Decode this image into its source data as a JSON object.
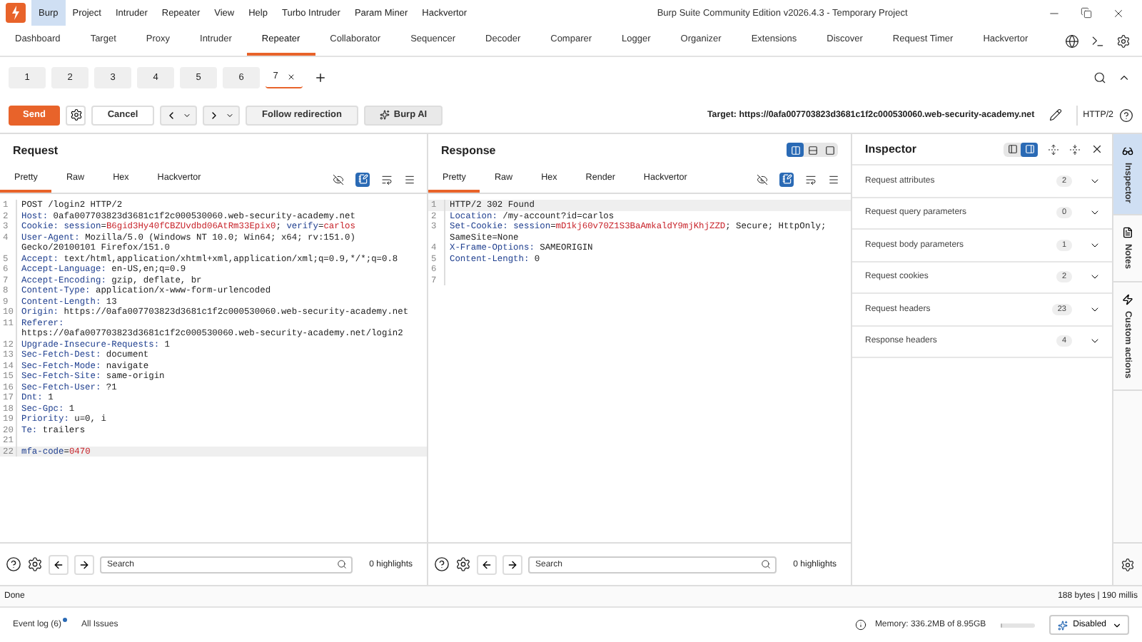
{
  "window": {
    "title": "Burp Suite Community Edition v2026.4.3 - Temporary Project"
  },
  "menu": [
    {
      "label": "Burp",
      "selected": true
    },
    {
      "label": "Project",
      "selected": false
    },
    {
      "label": "Intruder",
      "selected": false
    },
    {
      "label": "Repeater",
      "selected": false
    },
    {
      "label": "View",
      "selected": false
    },
    {
      "label": "Help",
      "selected": false
    },
    {
      "label": "Turbo Intruder",
      "selected": false
    },
    {
      "label": "Param Miner",
      "selected": false
    },
    {
      "label": "Hackvertor",
      "selected": false
    }
  ],
  "tabs": [
    {
      "label": "Dashboard",
      "selected": false
    },
    {
      "label": "Target",
      "selected": false
    },
    {
      "label": "Proxy",
      "selected": false
    },
    {
      "label": "Intruder",
      "selected": false
    },
    {
      "label": "Repeater",
      "selected": true
    },
    {
      "label": "Collaborator",
      "selected": false
    },
    {
      "label": "Sequencer",
      "selected": false
    },
    {
      "label": "Decoder",
      "selected": false
    },
    {
      "label": "Comparer",
      "selected": false
    },
    {
      "label": "Logger",
      "selected": false
    },
    {
      "label": "Organizer",
      "selected": false
    },
    {
      "label": "Extensions",
      "selected": false
    },
    {
      "label": "Discover",
      "selected": false
    },
    {
      "label": "Request Timer",
      "selected": false
    },
    {
      "label": "Hackvertor",
      "selected": false
    }
  ],
  "repeater_tabs": [
    {
      "label": "1",
      "selected": false
    },
    {
      "label": "2",
      "selected": false
    },
    {
      "label": "3",
      "selected": false
    },
    {
      "label": "4",
      "selected": false
    },
    {
      "label": "5",
      "selected": false
    },
    {
      "label": "6",
      "selected": false
    },
    {
      "label": "7",
      "selected": true
    }
  ],
  "toolbar": {
    "send": "Send",
    "cancel": "Cancel",
    "follow": "Follow redirection",
    "ai": "Burp AI",
    "target": "Target: https://0afa007703823d3681c1f2c000530060.web-security-academy.net",
    "protocol": "HTTP/2"
  },
  "request": {
    "title": "Request",
    "tabs": [
      {
        "label": "Pretty",
        "selected": true
      },
      {
        "label": "Raw",
        "selected": false
      },
      {
        "label": "Hex",
        "selected": false
      },
      {
        "label": "Hackvertor",
        "selected": false
      }
    ],
    "lines": [
      {
        "number": "1",
        "current": false,
        "segments": [
          {
            "text": "POST /login2 HTTP/2",
            "kind": "plain"
          }
        ]
      },
      {
        "number": "2",
        "current": false,
        "segments": [
          {
            "text": "Host:",
            "kind": "key"
          },
          {
            "text": " 0afa007703823d3681c1f2c000530060.web-security-academy.net",
            "kind": "plain"
          }
        ]
      },
      {
        "number": "3",
        "current": false,
        "segments": [
          {
            "text": "Cookie:",
            "kind": "key"
          },
          {
            "text": " session",
            "kind": "key"
          },
          {
            "text": "=",
            "kind": "plain"
          },
          {
            "text": "B6gid3Hy40fCBZUvdbd06AtRm33Epix0",
            "kind": "val"
          },
          {
            "text": "; ",
            "kind": "plain"
          },
          {
            "text": "verify",
            "kind": "key"
          },
          {
            "text": "=",
            "kind": "plain"
          },
          {
            "text": "carlos",
            "kind": "val"
          }
        ]
      },
      {
        "number": "4",
        "current": false,
        "segments": [
          {
            "text": "User-Agent:",
            "kind": "key"
          },
          {
            "text": " Mozilla/5.0 (Windows NT 10.0; Win64; x64; rv:151.0)",
            "kind": "plain"
          }
        ]
      },
      {
        "current": false,
        "segments": [
          {
            "text": "Gecko/20100101 Firefox/151.0",
            "kind": "plain"
          }
        ]
      },
      {
        "number": "5",
        "current": false,
        "segments": [
          {
            "text": "Accept:",
            "kind": "key"
          },
          {
            "text": " text/html,application/xhtml+xml,application/xml;q=0.9,*/*;q=0.8",
            "kind": "plain"
          }
        ]
      },
      {
        "number": "6",
        "current": false,
        "segments": [
          {
            "text": "Accept-Language:",
            "kind": "key"
          },
          {
            "text": " en-US,en;q=0.9",
            "kind": "plain"
          }
        ]
      },
      {
        "number": "7",
        "current": false,
        "segments": [
          {
            "text": "Accept-Encoding:",
            "kind": "key"
          },
          {
            "text": " gzip, deflate, br",
            "kind": "plain"
          }
        ]
      },
      {
        "number": "8",
        "current": false,
        "segments": [
          {
            "text": "Content-Type:",
            "kind": "key"
          },
          {
            "text": " application/x-www-form-urlencoded",
            "kind": "plain"
          }
        ]
      },
      {
        "number": "9",
        "current": false,
        "segments": [
          {
            "text": "Content-Length:",
            "kind": "key"
          },
          {
            "text": " 13",
            "kind": "plain"
          }
        ]
      },
      {
        "number": "10",
        "current": false,
        "segments": [
          {
            "text": "Origin:",
            "kind": "key"
          },
          {
            "text": " https://0afa007703823d3681c1f2c000530060.web-security-academy.net",
            "kind": "plain"
          }
        ]
      },
      {
        "number": "11",
        "current": false,
        "segments": [
          {
            "text": "Referer:",
            "kind": "key"
          }
        ]
      },
      {
        "current": false,
        "segments": [
          {
            "text": "https://0afa007703823d3681c1f2c000530060.web-security-academy.net/login2",
            "kind": "plain"
          }
        ]
      },
      {
        "number": "12",
        "current": false,
        "segments": [
          {
            "text": "Upgrade-Insecure-Requests:",
            "kind": "key"
          },
          {
            "text": " 1",
            "kind": "plain"
          }
        ]
      },
      {
        "number": "13",
        "current": false,
        "segments": [
          {
            "text": "Sec-Fetch-Dest:",
            "kind": "key"
          },
          {
            "text": " document",
            "kind": "plain"
          }
        ]
      },
      {
        "number": "14",
        "current": false,
        "segments": [
          {
            "text": "Sec-Fetch-Mode:",
            "kind": "key"
          },
          {
            "text": " navigate",
            "kind": "plain"
          }
        ]
      },
      {
        "number": "15",
        "current": false,
        "segments": [
          {
            "text": "Sec-Fetch-Site:",
            "kind": "key"
          },
          {
            "text": " same-origin",
            "kind": "plain"
          }
        ]
      },
      {
        "number": "16",
        "current": false,
        "segments": [
          {
            "text": "Sec-Fetch-User:",
            "kind": "key"
          },
          {
            "text": " ?1",
            "kind": "plain"
          }
        ]
      },
      {
        "number": "17",
        "current": false,
        "segments": [
          {
            "text": "Dnt:",
            "kind": "key"
          },
          {
            "text": " 1",
            "kind": "plain"
          }
        ]
      },
      {
        "number": "18",
        "current": false,
        "segments": [
          {
            "text": "Sec-Gpc:",
            "kind": "key"
          },
          {
            "text": " 1",
            "kind": "plain"
          }
        ]
      },
      {
        "number": "19",
        "current": false,
        "segments": [
          {
            "text": "Priority:",
            "kind": "key"
          },
          {
            "text": " u=0, i",
            "kind": "plain"
          }
        ]
      },
      {
        "number": "20",
        "current": false,
        "segments": [
          {
            "text": "Te:",
            "kind": "key"
          },
          {
            "text": " trailers",
            "kind": "plain"
          }
        ]
      },
      {
        "number": "21",
        "current": false
      },
      {
        "number": "22",
        "current": true,
        "segments": [
          {
            "text": "mfa-code",
            "kind": "key"
          },
          {
            "text": "=",
            "kind": "plain"
          },
          {
            "text": "0470",
            "kind": "val"
          }
        ]
      }
    ],
    "search": {
      "placeholder": "Search"
    },
    "highlights": "0 highlights"
  },
  "response": {
    "title": "Response",
    "tabs": [
      {
        "label": "Pretty",
        "selected": true
      },
      {
        "label": "Raw",
        "selected": false
      },
      {
        "label": "Hex",
        "selected": false
      },
      {
        "label": "Render",
        "selected": false
      },
      {
        "label": "Hackvertor",
        "selected": false
      }
    ],
    "layouts": [
      {
        "kind": "columns",
        "selected": true
      },
      {
        "kind": "rows",
        "selected": false
      },
      {
        "kind": "single",
        "selected": false
      }
    ],
    "lines": [
      {
        "number": "1",
        "current": true,
        "segments": [
          {
            "text": "HTTP/2 302 Found",
            "kind": "plain"
          }
        ]
      },
      {
        "number": "2",
        "current": false,
        "segments": [
          {
            "text": "Location:",
            "kind": "key"
          },
          {
            "text": " /my-account?id=carlos",
            "kind": "plain"
          }
        ]
      },
      {
        "number": "3",
        "current": false,
        "segments": [
          {
            "text": "Set-Cookie:",
            "kind": "key"
          },
          {
            "text": " session",
            "kind": "key"
          },
          {
            "text": "=",
            "kind": "plain"
          },
          {
            "text": "mD1kj60v70Z1S3BaAmkaldY9mjKhjZZD",
            "kind": "val"
          },
          {
            "text": "; Secure; HttpOnly;",
            "kind": "plain"
          }
        ]
      },
      {
        "current": false,
        "segments": [
          {
            "text": "SameSite=None",
            "kind": "plain"
          }
        ]
      },
      {
        "number": "4",
        "current": false,
        "segments": [
          {
            "text": "X-Frame-Options:",
            "kind": "key"
          },
          {
            "text": " SAMEORIGIN",
            "kind": "plain"
          }
        ]
      },
      {
        "number": "5",
        "current": false,
        "segments": [
          {
            "text": "Content-Length:",
            "kind": "key"
          },
          {
            "text": " 0",
            "kind": "plain"
          }
        ]
      },
      {
        "number": "6",
        "current": false
      },
      {
        "number": "7",
        "current": false
      }
    ],
    "search": {
      "placeholder": "Search"
    },
    "highlights": "0 highlights"
  },
  "inspector": {
    "title": "Inspector",
    "layouts": [
      {
        "kind": "split",
        "selected": false
      },
      {
        "kind": "full",
        "selected": true
      }
    ],
    "sections": [
      {
        "label": "Request attributes",
        "count": "2"
      },
      {
        "label": "Request query parameters",
        "count": "0"
      },
      {
        "label": "Request body parameters",
        "count": "1"
      },
      {
        "label": "Request cookies",
        "count": "2"
      },
      {
        "label": "Request headers",
        "count": "23"
      },
      {
        "label": "Response headers",
        "count": "4"
      }
    ]
  },
  "side_panel": [
    {
      "label": "Inspector",
      "kind": "inspector",
      "selected": true
    },
    {
      "label": "Notes",
      "kind": "notes",
      "selected": false
    },
    {
      "label": "Custom actions",
      "kind": "actions",
      "selected": false
    }
  ],
  "status_bar": {
    "left": "Done",
    "right": "188 bytes | 190 millis"
  },
  "footer": {
    "event_log": "Event log (6)",
    "issues": "All Issues",
    "memory": "Memory: 336.2MB of 8.95GB",
    "memory_bar": {
      "level": 0.04
    },
    "ai_mode": "Disabled"
  }
}
